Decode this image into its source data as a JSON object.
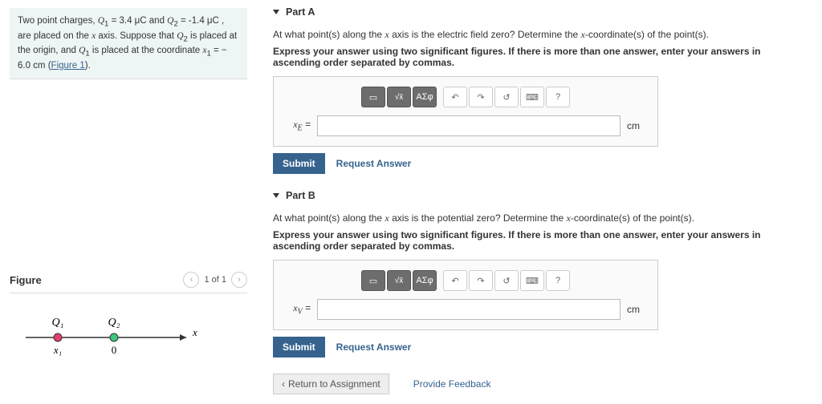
{
  "problem": {
    "text_html": "Two point charges, <span class='mono-italic'>Q</span><sub>1</sub> = 3.4 μC and <span class='mono-italic'>Q</span><sub>2</sub> = -1.4 μC , are placed on the <span class='mono-italic'>x</span> axis. Suppose that <span class='mono-italic'>Q</span><sub>2</sub> is placed at the origin, and <span class='mono-italic'>Q</span><sub>1</sub> is placed at the coordinate <span class='mono-italic'>x</span><sub>1</sub> = − 6.0 cm (<span style='color:#36638e;text-decoration:underline'>Figure 1</span>)."
  },
  "figure": {
    "title": "Figure",
    "pager": "1 of 1",
    "labels": {
      "q1": "Q₁",
      "q2": "Q₂",
      "x1": "x₁",
      "zero": "0",
      "axis": "x"
    }
  },
  "partA": {
    "title": "Part A",
    "question_html": "At what point(s) along the <span class='mono-italic'>x</span> axis is the electric field zero? Determine the <span class='mono-italic'>x</span>-coordinate(s) of the point(s).",
    "instruction": "Express your answer using two significant figures. If there is more than one answer, enter your answers in ascending order separated by commas.",
    "var_label_html": "<span class='mono-italic'>x</span><sub><span class='mono-italic'>E</span></sub> =",
    "unit": "cm",
    "submit": "Submit",
    "request": "Request Answer",
    "tb": {
      "greek": "ΑΣφ",
      "help": "?"
    }
  },
  "partB": {
    "title": "Part B",
    "question_html": "At what point(s) along the <span class='mono-italic'>x</span> axis is the potential zero? Determine the <span class='mono-italic'>x</span>-coordinate(s) of the point(s).",
    "instruction": "Express your answer using two significant figures. If there is more than one answer, enter your answers in ascending order separated by commas.",
    "var_label_html": "<span class='mono-italic'>x</span><sub><span class='mono-italic'>V</span></sub> =",
    "unit": "cm",
    "submit": "Submit",
    "request": "Request Answer",
    "tb": {
      "greek": "ΑΣφ",
      "help": "?"
    }
  },
  "footer": {
    "return": "Return to Assignment",
    "feedback": "Provide Feedback"
  }
}
